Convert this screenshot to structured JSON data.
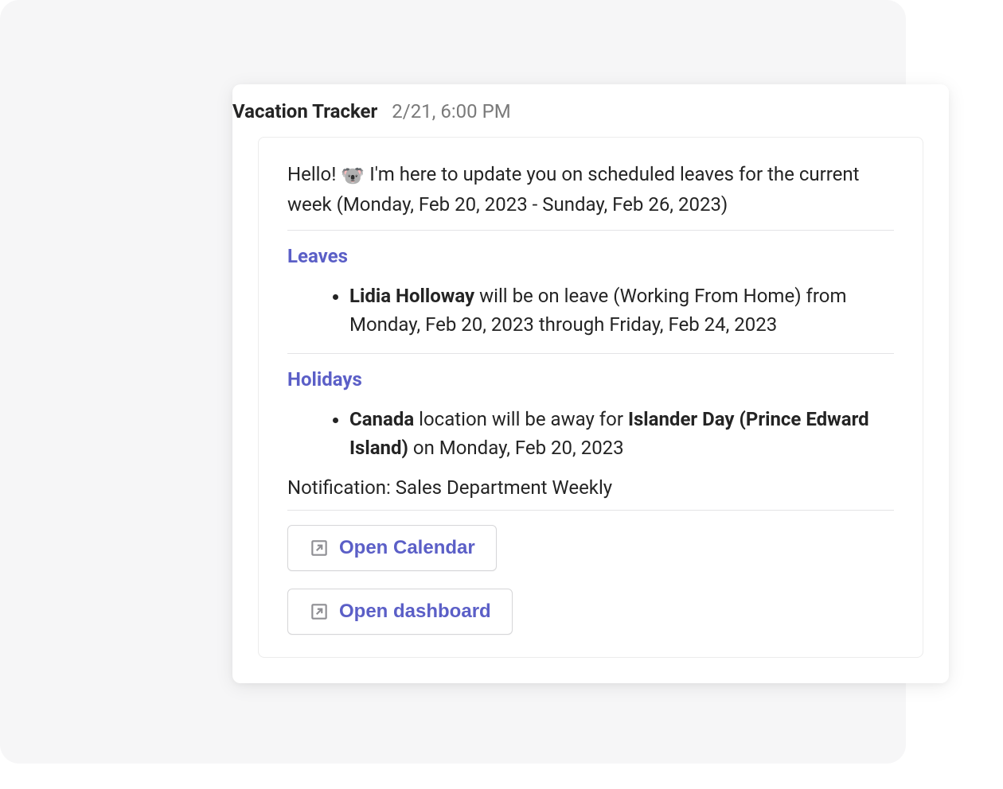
{
  "header": {
    "title": "Vacation Tracker",
    "timestamp": "2/21, 6:00 PM"
  },
  "intro": {
    "prefix": "Hello!",
    "emoji": "🐨",
    "rest": "I'm here to update you on scheduled leaves for the current week (Monday, Feb 20, 2023 - Sunday, Feb 26, 2023)"
  },
  "sections": {
    "leaves": {
      "heading": "Leaves",
      "item": {
        "name": "Lidia Holloway",
        "middle": " will be on leave (Working From Home) from Monday, Feb 20, 2023 through Friday, Feb 24, 2023"
      }
    },
    "holidays": {
      "heading": "Holidays",
      "item": {
        "location": "Canada",
        "middle": " location will be away for ",
        "holiday": "Islander Day (Prince Edward Island)",
        "suffix": " on Monday, Feb 20, 2023"
      }
    }
  },
  "notification": "Notification: Sales Department Weekly",
  "buttons": {
    "open_calendar": "Open Calendar",
    "open_dashboard": "Open dashboard"
  }
}
